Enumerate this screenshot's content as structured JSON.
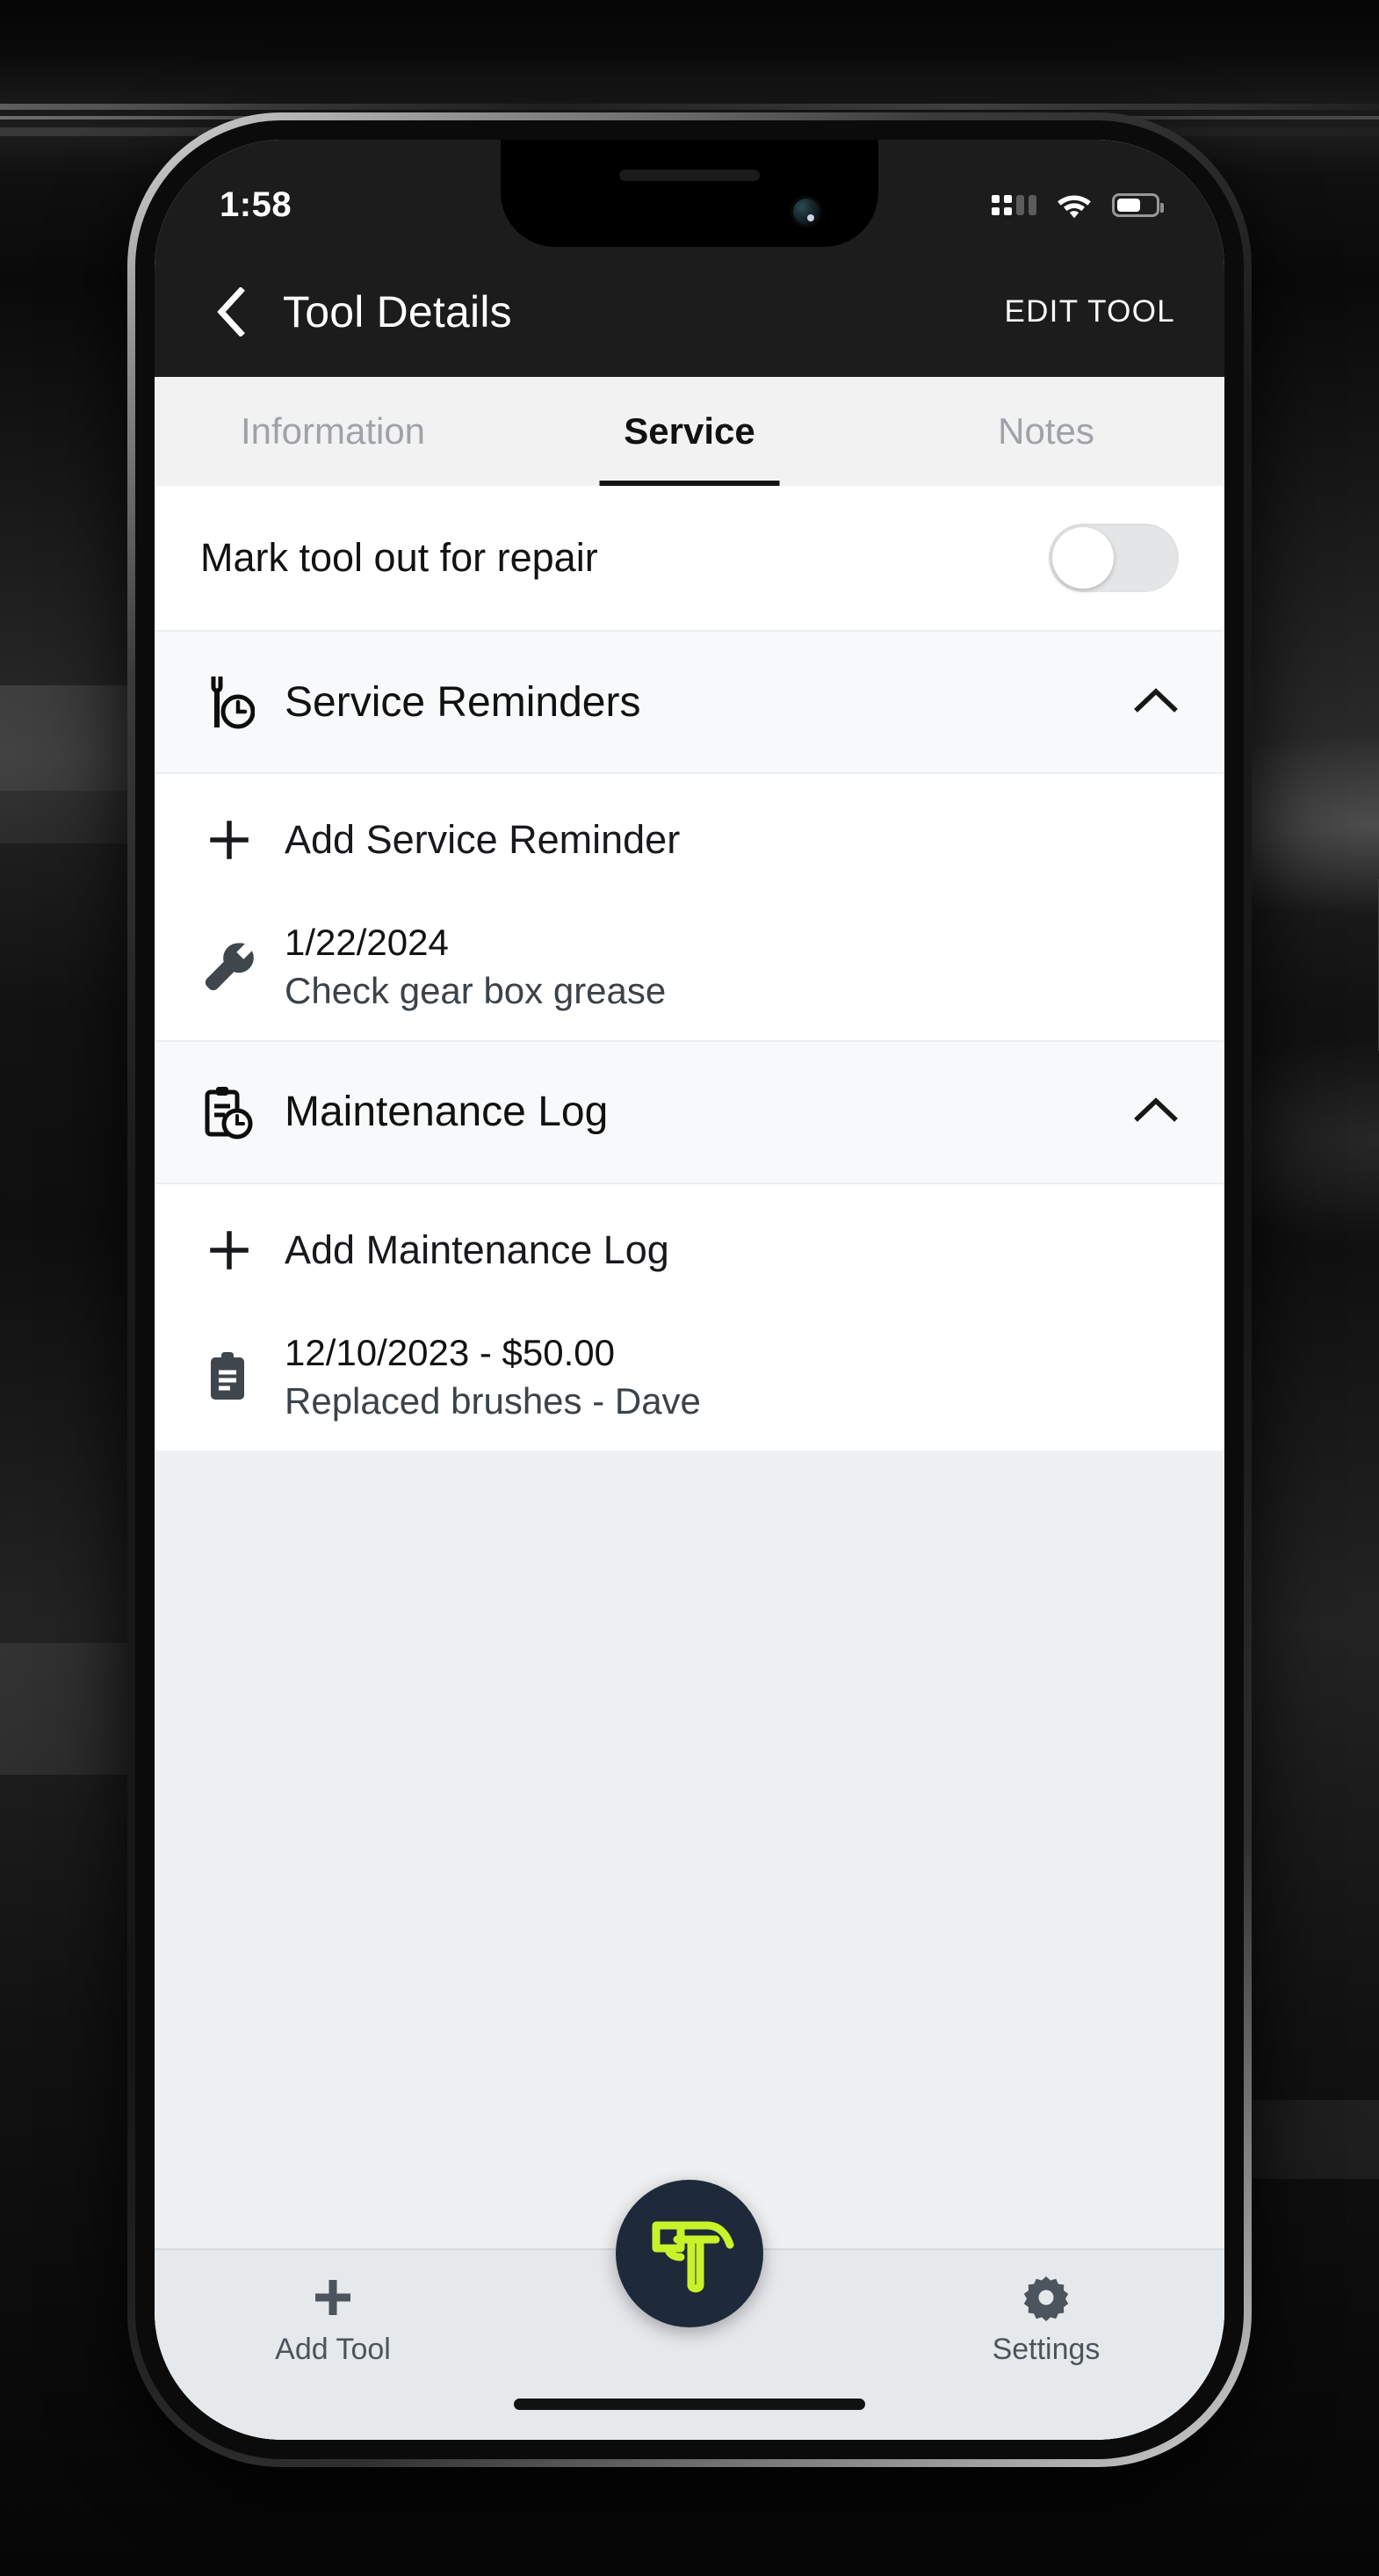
{
  "status_bar": {
    "time": "1:58",
    "cellular_icon": "cellular-signal-icon",
    "wifi_icon": "wifi-icon",
    "battery_icon": "battery-icon"
  },
  "nav": {
    "back_icon": "chevron-left-icon",
    "title": "Tool Details",
    "action_label": "EDIT TOOL"
  },
  "tabs": [
    {
      "label": "Information",
      "active": false
    },
    {
      "label": "Service",
      "active": true
    },
    {
      "label": "Notes",
      "active": false
    }
  ],
  "repair": {
    "label": "Mark tool out for repair",
    "toggle_state": "off",
    "toggle_icon": "toggle-switch-icon"
  },
  "sections": [
    {
      "title": "Service Reminders",
      "icon": "wrench-clock-icon",
      "chevron_icon": "chevron-up-icon",
      "expanded": true,
      "add_label": "Add Service Reminder",
      "add_icon": "plus-icon",
      "entries": [
        {
          "icon": "wrench-icon",
          "line1": "1/22/2024",
          "line2": "Check gear box grease"
        }
      ]
    },
    {
      "title": "Maintenance Log",
      "icon": "clipboard-clock-icon",
      "chevron_icon": "chevron-up-icon",
      "expanded": true,
      "add_label": "Add Maintenance Log",
      "add_icon": "plus-icon",
      "entries": [
        {
          "icon": "clipboard-icon",
          "line1": "12/10/2023 - $50.00",
          "line2": "Replaced brushes - Dave"
        }
      ]
    }
  ],
  "bottom_bar": {
    "add_tool_label": "Add Tool",
    "add_tool_icon": "plus-icon",
    "settings_label": "Settings",
    "settings_icon": "gear-icon",
    "fab_icon": "hammer-logo-icon"
  },
  "colors": {
    "accent_lime": "#c8f32a",
    "brand_navy": "#1e2a3a",
    "status_bar_bg": "#1c1c1c",
    "tab_bar_bg": "#f2f2f3",
    "content_bg": "#eef0f1",
    "section_header_bg": "#f8f9fb",
    "bottom_bar_bg": "#e6e9ec",
    "tab_inactive": "#9fa3a8"
  }
}
